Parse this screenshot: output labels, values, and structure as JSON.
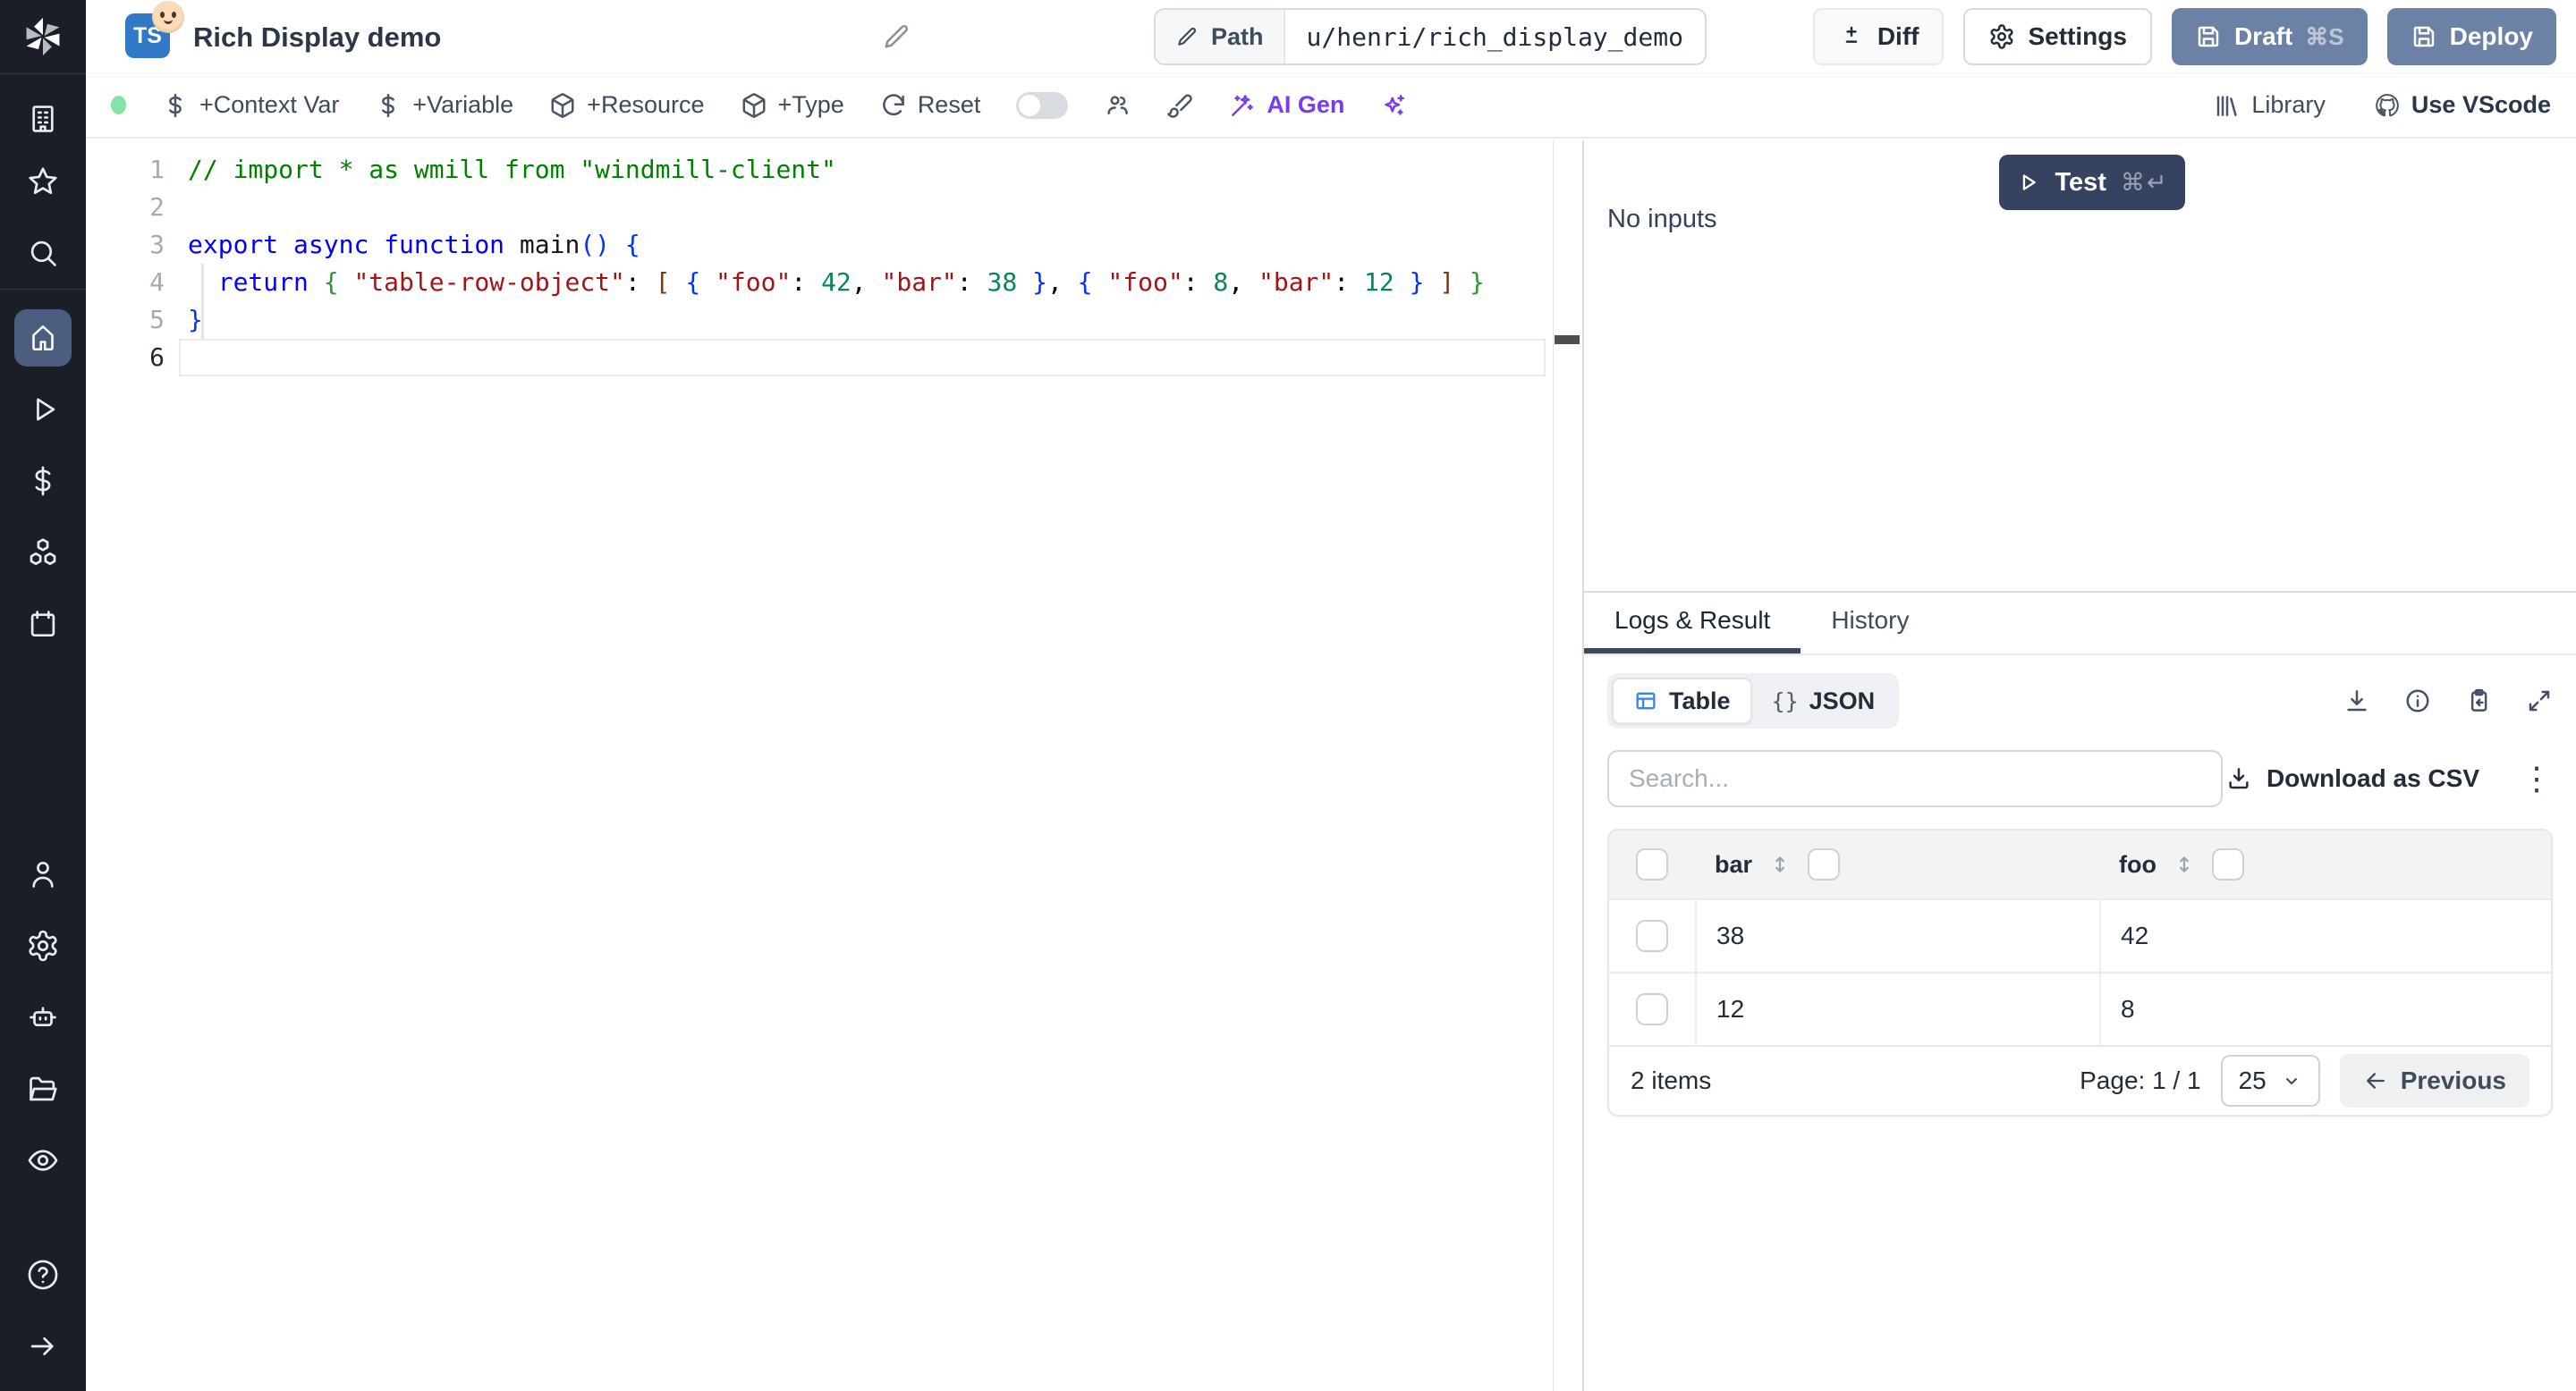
{
  "header": {
    "language_badge": "TS",
    "title": "Rich Display demo",
    "path_label": "Path",
    "path_value": "u/henri/rich_display_demo",
    "diff_label": "Diff",
    "settings_label": "Settings",
    "draft_label": "Draft",
    "draft_shortcut": "⌘S",
    "deploy_label": "Deploy"
  },
  "toolbar": {
    "status_color": "#86e3a7",
    "context_var": "+Context Var",
    "variable": "+Variable",
    "resource": "+Resource",
    "type": "+Type",
    "reset": "Reset",
    "ai_gen": "AI Gen",
    "library": "Library",
    "vscode": "Use VScode",
    "ai_accent": "#7c3aed"
  },
  "sidebar": {
    "icons": [
      "windmill-logo",
      "building",
      "star",
      "search",
      "home",
      "play",
      "dollar",
      "boxes",
      "calendar",
      "user",
      "gear",
      "bot",
      "folder-open",
      "eye",
      "help",
      "arrow-right"
    ],
    "active_item": "home",
    "active_bg": "#4c5d80"
  },
  "editor": {
    "lines": [
      {
        "n": "1",
        "tokens": [
          {
            "c": "cm",
            "t": "// import * as wmill from \"windmill-client\""
          }
        ]
      },
      {
        "n": "2",
        "tokens": []
      },
      {
        "n": "3",
        "tokens": [
          {
            "c": "kw",
            "t": "export"
          },
          {
            "c": "pun",
            "t": " "
          },
          {
            "c": "kw",
            "t": "async"
          },
          {
            "c": "pun",
            "t": " "
          },
          {
            "c": "kw",
            "t": "function"
          },
          {
            "c": "pun",
            "t": " "
          },
          {
            "c": "id",
            "t": "main"
          },
          {
            "c": "b0",
            "t": "()"
          },
          {
            "c": "pun",
            "t": " "
          },
          {
            "c": "b0",
            "t": "{"
          }
        ]
      },
      {
        "n": "4",
        "tokens": [
          {
            "c": "pun",
            "t": "  "
          },
          {
            "c": "kw",
            "t": "return"
          },
          {
            "c": "pun",
            "t": " "
          },
          {
            "c": "b1",
            "t": "{"
          },
          {
            "c": "pun",
            "t": " "
          },
          {
            "c": "str",
            "t": "\"table-row-object\""
          },
          {
            "c": "pun",
            "t": ": "
          },
          {
            "c": "b2",
            "t": "["
          },
          {
            "c": "pun",
            "t": " "
          },
          {
            "c": "b0",
            "t": "{"
          },
          {
            "c": "pun",
            "t": " "
          },
          {
            "c": "str",
            "t": "\"foo\""
          },
          {
            "c": "pun",
            "t": ": "
          },
          {
            "c": "num",
            "t": "42"
          },
          {
            "c": "pun",
            "t": ", "
          },
          {
            "c": "str",
            "t": "\"bar\""
          },
          {
            "c": "pun",
            "t": ": "
          },
          {
            "c": "num",
            "t": "38"
          },
          {
            "c": "pun",
            "t": " "
          },
          {
            "c": "b0",
            "t": "}"
          },
          {
            "c": "pun",
            "t": ", "
          },
          {
            "c": "b0",
            "t": "{"
          },
          {
            "c": "pun",
            "t": " "
          },
          {
            "c": "str",
            "t": "\"foo\""
          },
          {
            "c": "pun",
            "t": ": "
          },
          {
            "c": "num",
            "t": "8"
          },
          {
            "c": "pun",
            "t": ", "
          },
          {
            "c": "str",
            "t": "\"bar\""
          },
          {
            "c": "pun",
            "t": ": "
          },
          {
            "c": "num",
            "t": "12"
          },
          {
            "c": "pun",
            "t": " "
          },
          {
            "c": "b0",
            "t": "}"
          },
          {
            "c": "pun",
            "t": " "
          },
          {
            "c": "b2",
            "t": "]"
          },
          {
            "c": "pun",
            "t": " "
          },
          {
            "c": "b1",
            "t": "}"
          }
        ]
      },
      {
        "n": "5",
        "tokens": [
          {
            "c": "b0",
            "t": "}"
          }
        ]
      },
      {
        "n": "6",
        "tokens": [],
        "current": true
      }
    ]
  },
  "run_panel": {
    "test_label": "Test",
    "test_shortcut": "⌘↵",
    "no_inputs": "No inputs",
    "test_button_color": "#354361"
  },
  "result_panel": {
    "tabs": {
      "logs_result": "Logs & Result",
      "history": "History"
    },
    "active_tab": "Logs & Result",
    "view_toggle": {
      "table_label": "Table",
      "json_label": "JSON",
      "json_glyph": "{}"
    },
    "search_placeholder": "Search...",
    "download_csv_label": "Download as CSV",
    "kebab_glyph": "⋮",
    "table": {
      "columns": [
        "bar",
        "foo"
      ],
      "rows": [
        [
          "38",
          "42"
        ],
        [
          "12",
          "8"
        ]
      ],
      "items_label": "2 items",
      "page_label": "Page: 1 / 1",
      "page_size": "25",
      "previous_label": "Previous"
    }
  }
}
